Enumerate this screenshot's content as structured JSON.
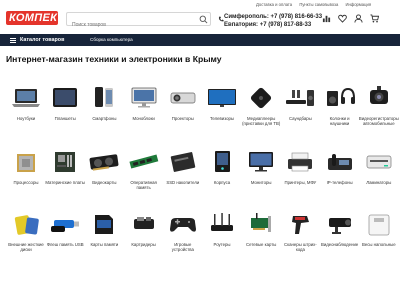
{
  "header": {
    "logo_text": "КОМПЕК",
    "top_links": [
      "Доставка и оплата",
      "Пункты самовывоза",
      "Информация"
    ],
    "search_placeholder": "Поиск товаров",
    "phone1": "Симферополь: +7 (978) 816-66-33",
    "phone2": "Евпатория: +7 (978) 817-88-33",
    "icons": [
      "chart-icon",
      "heart-icon",
      "user-icon",
      "cart-icon"
    ]
  },
  "nav": {
    "catalog_label": "Каталог товаров",
    "assembly_label": "Сборка компьютера"
  },
  "page_title": "Интернет-магазин техники и электроники в Крыму",
  "categories": [
    {
      "label": "Ноутбуки",
      "icon": "laptop-icon"
    },
    {
      "label": "Планшеты",
      "icon": "tablet-icon"
    },
    {
      "label": "Смартфоны",
      "icon": "smartphone-icon"
    },
    {
      "label": "Моноблоки",
      "icon": "monoblock-icon"
    },
    {
      "label": "Проекторы",
      "icon": "projector-icon"
    },
    {
      "label": "Телевизоры",
      "icon": "tv-icon"
    },
    {
      "label": "Медиаплееры (приставки для ТВ)",
      "icon": "mediaplayer-icon"
    },
    {
      "label": "Саундбары",
      "icon": "soundbar-icon"
    },
    {
      "label": "Колонки и наушники",
      "icon": "speakers-icon"
    },
    {
      "label": "Видеорегистраторы автомобильные",
      "icon": "dashcam-icon"
    },
    {
      "label": "Процессоры",
      "icon": "cpu-icon"
    },
    {
      "label": "Материнские платы",
      "icon": "motherboard-icon"
    },
    {
      "label": "Видеокарты",
      "icon": "gpu-icon"
    },
    {
      "label": "Оперативная память",
      "icon": "ram-icon"
    },
    {
      "label": "SSD накопители",
      "icon": "ssd-icon"
    },
    {
      "label": "Корпуса",
      "icon": "pc-case-icon"
    },
    {
      "label": "Мониторы",
      "icon": "monitor-icon"
    },
    {
      "label": "Принтеры, МФУ",
      "icon": "printer-icon"
    },
    {
      "label": "IP-телефоны",
      "icon": "ip-phone-icon"
    },
    {
      "label": "Ламинаторы",
      "icon": "laminator-icon"
    },
    {
      "label": "Внешние жесткие диски",
      "icon": "external-hdd-icon"
    },
    {
      "label": "Флеш память USB",
      "icon": "usb-flash-icon"
    },
    {
      "label": "Карты памяти",
      "icon": "memory-card-icon"
    },
    {
      "label": "Картридеры",
      "icon": "cardreader-icon"
    },
    {
      "label": "Игровые устройства",
      "icon": "gamepad-icon"
    },
    {
      "label": "Роутеры",
      "icon": "router-icon"
    },
    {
      "label": "Сетевые карты",
      "icon": "network-card-icon"
    },
    {
      "label": "Сканеры штрих-кода",
      "icon": "barcode-scanner-icon"
    },
    {
      "label": "Видеонаблюдение",
      "icon": "camera-icon"
    },
    {
      "label": "Весы напольные",
      "icon": "scales-icon"
    }
  ],
  "colors": {
    "brand_red": "#e4342b",
    "nav_dark": "#17243a"
  }
}
